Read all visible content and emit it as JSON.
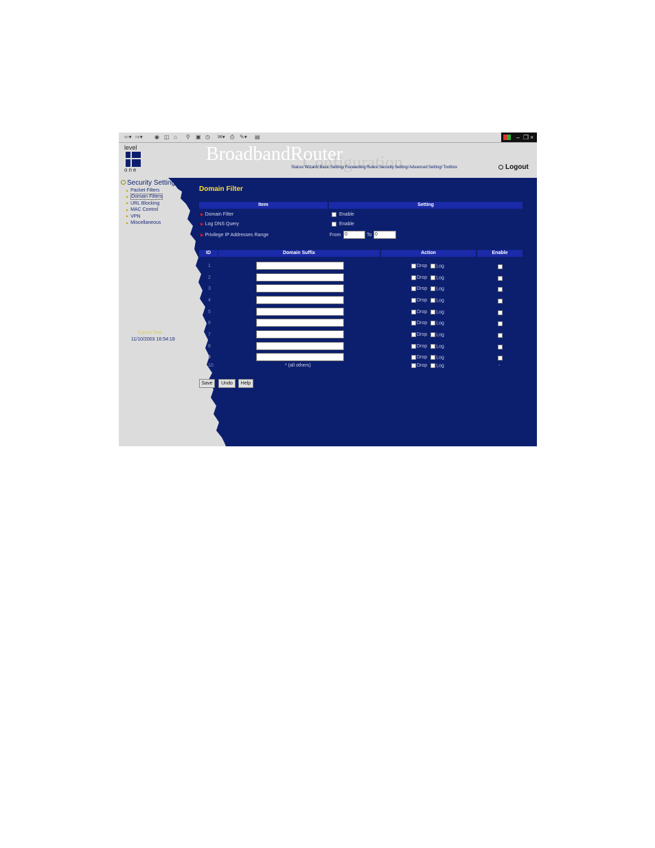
{
  "header": {
    "brand": "BroadbandRouter",
    "brand_sub": "Configuration",
    "logo_top": "level",
    "logo_bottom": "one",
    "nav": "Status/ Wizard/ Basic Setting/ Forwarding Rules/ Security Setting/ Advanced Setting/ Toolbox",
    "logout": "Logout"
  },
  "sidebar": {
    "title": "Security Setting",
    "items": [
      {
        "label": "Packet Filters"
      },
      {
        "label": "Domain Filters"
      },
      {
        "label": "URL Blocking"
      },
      {
        "label": "MAC Control"
      },
      {
        "label": "VPN"
      },
      {
        "label": "Miscellaneous"
      }
    ],
    "current_time_label": "Current Time",
    "current_time": "11/10/2003 16:54:18"
  },
  "main": {
    "title": "Domain Filter",
    "settings_header": {
      "item": "Item",
      "setting": "Setting"
    },
    "settings": {
      "domain_filter_label": "Domain Filter",
      "domain_filter_enable": "Enable",
      "log_dns_label": "Log DNS Query",
      "log_dns_enable": "Enable",
      "priv_ip_label": "Privilege IP Addresses Range",
      "from_label": "From",
      "from_value": "0",
      "to_label": "To",
      "to_value": "0"
    },
    "table_header": {
      "id": "ID",
      "domain": "Domain Suffix",
      "action": "Action",
      "enable": "Enable"
    },
    "rows": [
      {
        "id": "1",
        "drop": "Drop",
        "log": "Log"
      },
      {
        "id": "2",
        "drop": "Drop",
        "log": "Log"
      },
      {
        "id": "3",
        "drop": "Drop",
        "log": "Log"
      },
      {
        "id": "4",
        "drop": "Drop",
        "log": "Log"
      },
      {
        "id": "5",
        "drop": "Drop",
        "log": "Log"
      },
      {
        "id": "6",
        "drop": "Drop",
        "log": "Log"
      },
      {
        "id": "7",
        "drop": "Drop",
        "log": "Log"
      },
      {
        "id": "8",
        "drop": "Drop",
        "log": "Log"
      },
      {
        "id": "9",
        "drop": "Drop",
        "log": "Log"
      }
    ],
    "last_row": {
      "id": "10",
      "domain": "* (all others)",
      "drop": "Drop",
      "log": "Log",
      "enable": "-"
    },
    "buttons": {
      "save": "Save",
      "undo": "Undo",
      "help": "Help"
    }
  },
  "colors": {
    "main_bg": "#0c1f6e",
    "side_bg": "#dcdcdc",
    "header_bg": "#1a2aa8",
    "title": "#ffdd33",
    "arrow": "#e21a1a"
  }
}
